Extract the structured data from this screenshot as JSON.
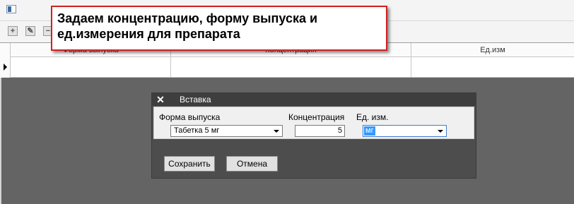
{
  "toolbar": {
    "buttons": [
      {
        "icon": "plus-icon",
        "glyph": "+"
      },
      {
        "icon": "edit-icon",
        "glyph": "✎"
      },
      {
        "icon": "minus-icon",
        "glyph": "−"
      }
    ]
  },
  "grid": {
    "columns": [
      "Форма выпуска",
      "Концентрация",
      "Ед.изм"
    ]
  },
  "callout": {
    "text": "Задаем концентрацию, форму выпуска и ед.измерения для препарата"
  },
  "dialog": {
    "title": "Вставка",
    "close_glyph": "✕",
    "form_label": "Форма выпуска",
    "form_value": "Табетка 5 мг",
    "conc_label": "Концентрация",
    "conc_value": "5",
    "unit_label": "Ед. изм.",
    "unit_value": "мг",
    "save_label": "Сохранить",
    "cancel_label": "Отмена"
  },
  "colors": {
    "callout_border": "#d42020",
    "overlay": "#646464",
    "selection": "#3399ff"
  }
}
